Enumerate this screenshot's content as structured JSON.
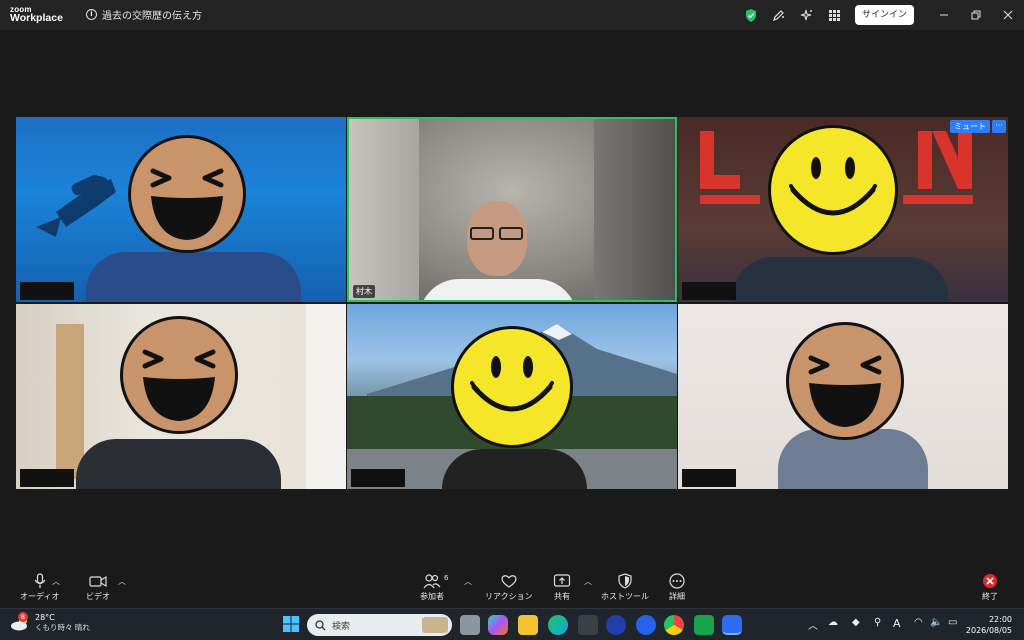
{
  "titlebar": {
    "logo_top": "zoom",
    "logo_bottom": "Workplace",
    "info_text": "過去の交際歴の伝え方",
    "signin_label": "サインイン"
  },
  "participants": [
    {
      "name": "",
      "face": "laugh",
      "name_visible": false
    },
    {
      "name": "村木",
      "face": "none",
      "name_visible": true,
      "active_speaker": true
    },
    {
      "name": "",
      "face": "smile",
      "name_visible": false
    },
    {
      "name": "",
      "face": "laugh",
      "name_visible": false
    },
    {
      "name": "",
      "face": "smile",
      "name_visible": false
    },
    {
      "name": "",
      "face": "laugh",
      "name_visible": false
    }
  ],
  "tile_controls": {
    "mute_label": "ミュート",
    "more_label": "···"
  },
  "toolbar": {
    "audio_label": "オーディオ",
    "video_label": "ビデオ",
    "participants_label": "参加者",
    "participants_count": "6",
    "reactions_label": "リアクション",
    "share_label": "共有",
    "host_tools_label": "ホストツール",
    "details_label": "詳細",
    "end_label": "終了"
  },
  "taskbar": {
    "weather_temp": "28°C",
    "weather_text": "くもり時々 晴れ",
    "weather_badge": "8",
    "search_placeholder": "検索",
    "ime_label": "A",
    "time": "22:00",
    "date": "2026/08/05"
  },
  "colors": {
    "active_speaker_border": "#22c55e",
    "mute_button": "#2d7ff9",
    "end_button": "#e02828"
  }
}
